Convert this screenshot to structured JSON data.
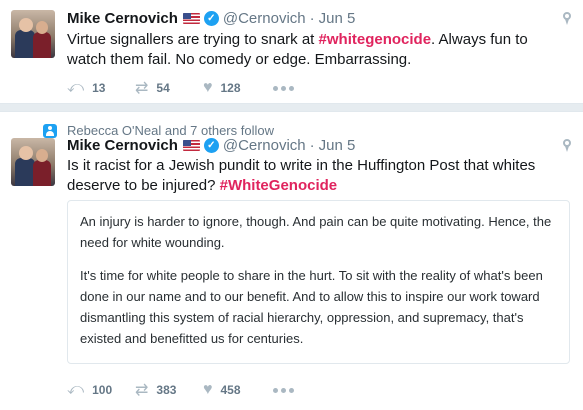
{
  "tweets": [
    {
      "author": {
        "name": "Mike Cernovich",
        "handle": "@Cernovich",
        "date": "Jun 5"
      },
      "text_before": "Virtue signallers are trying to snark at ",
      "hashtag": "#whitegenocide",
      "text_after": ". Always fun to watch them fail. No comedy or edge. Embarrassing.",
      "stats": {
        "replies": "13",
        "retweets": "54",
        "likes": "128"
      }
    },
    {
      "context": "Rebecca O'Neal and 7 others follow",
      "author": {
        "name": "Mike Cernovich",
        "handle": "@Cernovich",
        "date": "Jun 5"
      },
      "text_before": "Is it racist for a Jewish pundit to write in the Huffington Post that whites deserve to be injured? ",
      "hashtag": "#WhiteGenocide",
      "quote": {
        "para1": "An injury is harder to ignore, though. And pain can be quite motivating. Hence, the need for white wounding.",
        "para2": "It's time for white people to share in the hurt. To sit with the reality of what's been done in our name and to our benefit. And to allow this to inspire our work toward dismantling this system of racial hierarchy, oppression, and supremacy, that's existed and benefitted us for centuries."
      },
      "stats": {
        "replies": "100",
        "retweets": "383",
        "likes": "458"
      }
    }
  ],
  "icons": {
    "reply": "reply-icon",
    "retweet": "retweet-icon",
    "like": "heart-icon",
    "more": "more-dots-icon",
    "verified": "verified-badge-icon",
    "flag": "us-flag-icon",
    "location": "location-pin-icon",
    "follow_context": "person-icon"
  },
  "colors": {
    "hashtag": "#e0245e",
    "secondary_text": "#657786",
    "verified": "#1da1f2",
    "separator": "#e6ecf0"
  }
}
